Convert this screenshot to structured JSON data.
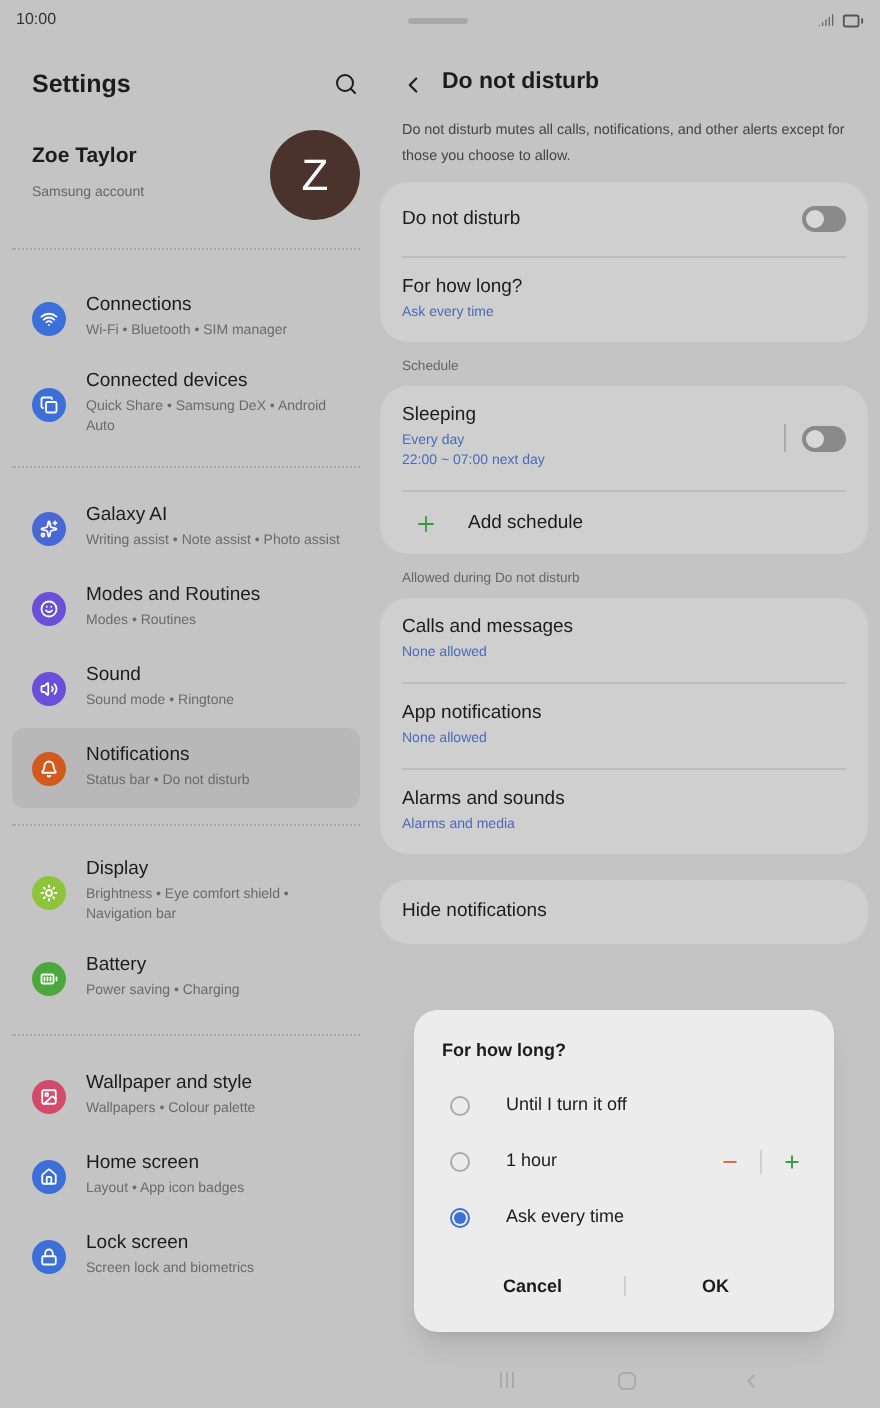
{
  "status_bar": {
    "time": "10:00"
  },
  "sidebar": {
    "title": "Settings",
    "account": {
      "name": "Zoe Taylor",
      "subtitle": "Samsung account",
      "avatar_letter": "Z"
    },
    "groups": [
      {
        "items": [
          {
            "kind": "wifi",
            "label": "Connections",
            "subtitle": "Wi-Fi  •  Bluetooth  •  SIM manager",
            "color": "#3d6fd8",
            "selected": false
          },
          {
            "kind": "devices",
            "label": "Connected devices",
            "subtitle": "Quick Share  •  Samsung DeX  •  Android Auto",
            "color": "#3d6fd8",
            "selected": false
          }
        ]
      },
      {
        "items": [
          {
            "kind": "sparkles",
            "label": "Galaxy AI",
            "subtitle": "Writing assist  •  Note assist  •  Photo assist",
            "color": "#4a67d6",
            "selected": false
          },
          {
            "kind": "routines",
            "label": "Modes and Routines",
            "subtitle": "Modes  •  Routines",
            "color": "#6a4fd8",
            "selected": false
          },
          {
            "kind": "sound",
            "label": "Sound",
            "subtitle": "Sound mode  •  Ringtone",
            "color": "#6a4fd8",
            "selected": false
          },
          {
            "kind": "bell",
            "label": "Notifications",
            "subtitle": "Status bar  •  Do not disturb",
            "color": "#d35a1f",
            "selected": true
          }
        ]
      },
      {
        "items": [
          {
            "kind": "sun",
            "label": "Display",
            "subtitle": "Brightness  •  Eye comfort shield  •  Navigation bar",
            "color": "#8dc43c",
            "selected": false
          },
          {
            "kind": "battery",
            "label": "Battery",
            "subtitle": "Power saving  •  Charging",
            "color": "#4ca83c",
            "selected": false
          }
        ]
      },
      {
        "items": [
          {
            "kind": "image",
            "label": "Wallpaper and style",
            "subtitle": "Wallpapers  •  Colour palette",
            "color": "#d24a6c",
            "selected": false
          },
          {
            "kind": "home",
            "label": "Home screen",
            "subtitle": "Layout  •  App icon badges",
            "color": "#3d6fd8",
            "selected": false
          },
          {
            "kind": "lock",
            "label": "Lock screen",
            "subtitle": "Screen lock and biometrics",
            "color": "#3d6fd8",
            "selected": false
          }
        ]
      }
    ]
  },
  "detail": {
    "title": "Do not disturb",
    "description": "Do not disturb mutes all calls, notifications, and other alerts except for those you choose to allow.",
    "sections": [
      {
        "cards": [
          {
            "rows": [
              {
                "kind": "toggle",
                "label": "Do not disturb",
                "on": false
              },
              {
                "kind": "link",
                "label": "For how long?",
                "subtitle": "Ask every time"
              }
            ]
          }
        ]
      },
      {
        "header": "Schedule",
        "cards": [
          {
            "rows": [
              {
                "kind": "toggle",
                "label": "Sleeping",
                "subtitle": "Every day\n22:00 ~ 07:00 next day",
                "on": false
              },
              {
                "kind": "add",
                "label": "Add schedule"
              }
            ]
          }
        ]
      },
      {
        "header": "Allowed during Do not disturb",
        "cards": [
          {
            "rows": [
              {
                "kind": "link",
                "label": "Calls and messages",
                "subtitle": "None allowed"
              },
              {
                "kind": "link",
                "label": "App notifications",
                "subtitle": "None allowed"
              },
              {
                "kind": "link",
                "label": "Alarms and sounds",
                "subtitle": "Alarms and media"
              }
            ]
          },
          {
            "rows": [
              {
                "kind": "link",
                "label": "Hide notifications"
              }
            ]
          }
        ]
      }
    ]
  },
  "dialog": {
    "title": "For how long?",
    "options": [
      {
        "kind": "plain",
        "label": "Until I turn it off",
        "selected": false
      },
      {
        "kind": "stepper",
        "label": "1 hour",
        "selected": false
      },
      {
        "kind": "plain",
        "label": "Ask every time",
        "selected": true
      }
    ],
    "buttons": [
      "Cancel",
      "OK"
    ]
  }
}
